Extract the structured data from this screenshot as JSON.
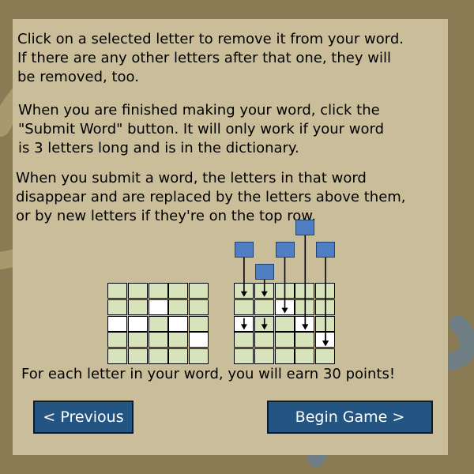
{
  "instructions": {
    "para1": "Click on a selected letter to remove it from your word.\nIf there are any other letters after that one, they will\nbe removed, too.",
    "para2": "When you are finished making your word, click the\n\"Submit Word\" button. It will only work if your word\nis 3 letters long and is in the dictionary.",
    "para3": "When you submit a word, the letters in that word\ndisappear and are replaced by the letters above them,\nor by new letters if they're on the top row.",
    "points": "For each letter in your word, you will earn 30 points!"
  },
  "buttons": {
    "previous": "< Previous",
    "begin": "Begin Game >"
  },
  "colors": {
    "cell_fill": "#d7e3bb",
    "cell_selected": "#ffffff",
    "tile_fill": "#4f7fc2",
    "button_fill": "#245482"
  },
  "diagram": {
    "rows": 5,
    "cols": 5,
    "before_selected": [
      [
        1,
        2
      ],
      [
        2,
        0
      ],
      [
        2,
        1
      ],
      [
        2,
        3
      ],
      [
        3,
        4
      ]
    ],
    "after_selected": [
      [
        1,
        2
      ],
      [
        2,
        0
      ],
      [
        2,
        3
      ],
      [
        3,
        4
      ]
    ],
    "falling_tiles": [
      {
        "col": 0,
        "rise": 2
      },
      {
        "col": 1,
        "rise": 1
      },
      {
        "col": 2,
        "rise": 2
      },
      {
        "col": 3,
        "rise": 3
      },
      {
        "col": 4,
        "rise": 2
      }
    ]
  }
}
